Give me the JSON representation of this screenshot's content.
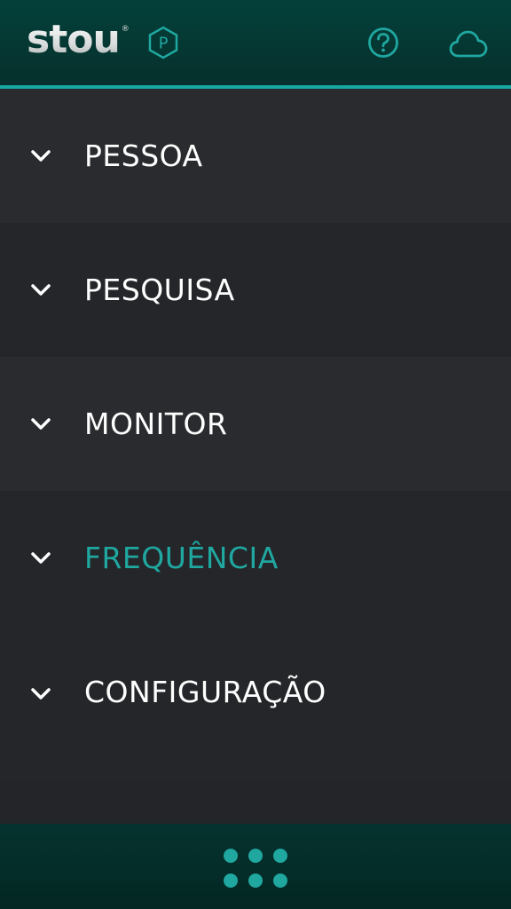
{
  "header": {
    "logo_text": "stou",
    "logo_mark": "®",
    "plan_badge_letter": "P",
    "icons": [
      "plan-badge-icon",
      "help-icon",
      "cloud-icon"
    ]
  },
  "menu": {
    "items": [
      {
        "label": "PESSOA",
        "active": false
      },
      {
        "label": "PESQUISA",
        "active": false
      },
      {
        "label": "MONITOR",
        "active": false
      },
      {
        "label": "FREQUÊNCIA",
        "active": true
      },
      {
        "label": "CONFIGURAÇÃO",
        "active": false
      }
    ]
  },
  "bottom_bar": {
    "icon": "apps-grid-icon"
  },
  "colors": {
    "accent": "#1fa7a0",
    "header_bg": "#04403a",
    "menu_bg": "#292b2e",
    "menu_bg_alt": "#242629",
    "text": "#ffffff"
  }
}
